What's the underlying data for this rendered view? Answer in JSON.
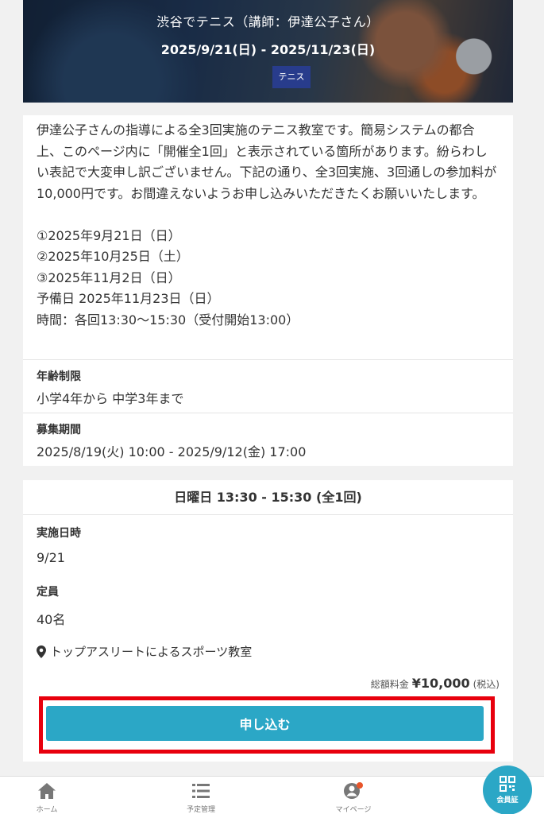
{
  "hero": {
    "title": "渋谷でテニス（講師：伊達公子さん）",
    "dates": "2025/9/21(日) - 2025/11/23(日)",
    "tag": "テニス"
  },
  "description": {
    "text": "伊達公子さんの指導による全3回実施のテニス教室です。簡易システムの都合上、このページ内に「開催全1回」と表示されている箇所があります。紛らわしい表記で大変申し訳ございません。下記の通り、全3回実施、3回通しの参加料が10,000円です。お間違えないようお申し込みいただきたくお願いいたします。\n\n①2025年9月21日（日）\n②2025年10月25日（土）\n③2025年11月2日（日）\n予備日 2025年11月23日（日）\n時間：各回13:30〜15:30（受付開始13:00）"
  },
  "age_limit": {
    "label": "年齢制限",
    "value": "小学4年から 中学3年まで"
  },
  "recruitment": {
    "label": "募集期間",
    "value": "2025/8/19(火) 10:00 - 2025/9/12(金) 17:00"
  },
  "session": {
    "header": "日曜日 13:30 - 15:30 (全1回)",
    "date_label": "実施日時",
    "date_value": "9/21",
    "capacity_label": "定員",
    "capacity_value": "40名",
    "location": "トップアスリートによるスポーツ教室",
    "price_label": "総額料金",
    "price_amount": "¥10,000",
    "price_tax": "(税込)",
    "apply_label": "申し込む"
  },
  "nav": {
    "home": "ホーム",
    "schedule": "予定管理",
    "mypage": "マイページ",
    "member_card": "会員証"
  },
  "colors": {
    "accent": "#2ba7c6",
    "tag_bg": "#283c8c",
    "highlight": "#e8000d",
    "notification_dot": "#e8552a"
  }
}
